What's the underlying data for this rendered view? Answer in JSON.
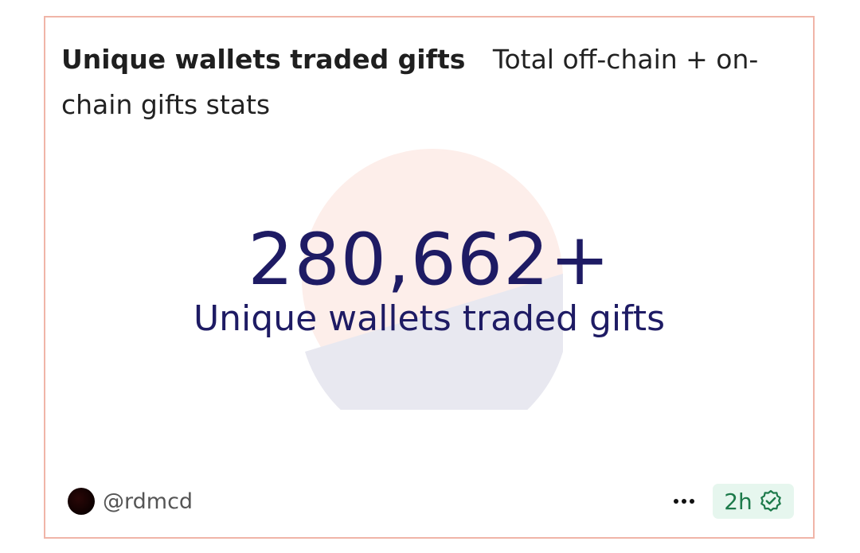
{
  "card": {
    "title": "Unique wallets traded gifts",
    "subtitle": "Total off-chain + on-chain gifts stats"
  },
  "metric": {
    "value": "280,662+",
    "label": "Unique wallets traded gifts"
  },
  "footer": {
    "handle": "@rdmcd",
    "age": "2h",
    "menu_icon": "more-horizontal-icon",
    "verified_icon": "verified-check-icon"
  },
  "colors": {
    "card_border": "#f0b5a8",
    "metric_text": "#1e1b64",
    "pie_slice_a": "#fdeeea",
    "pie_slice_b": "#e8e8f0",
    "badge_bg": "#e6f6ee",
    "badge_text": "#1c7a4a"
  }
}
